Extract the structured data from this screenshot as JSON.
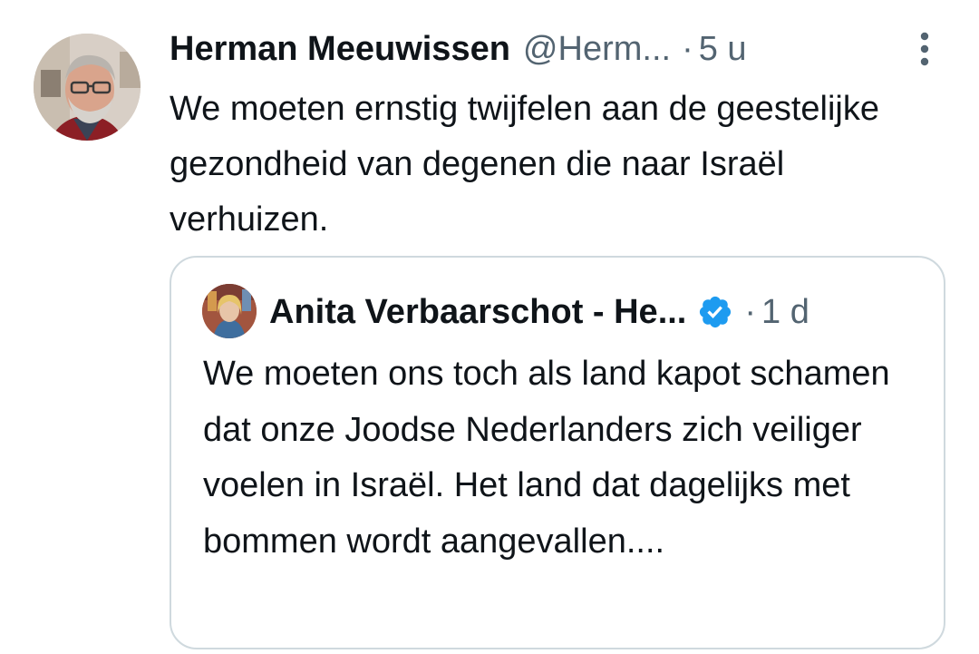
{
  "tweet": {
    "author_name": "Herman Meeuwissen",
    "author_handle": "@Herm...",
    "separator": "·",
    "time": "5 u",
    "text": "We moeten ernstig twijfelen aan de geestelijke gezondheid van degenen die naar Israël verhuizen."
  },
  "quoted_tweet": {
    "author_name": "Anita Verbaarschot - He...",
    "verified": true,
    "separator": "·",
    "time": "1 d",
    "text": "We moeten ons toch als land kapot schamen dat onze Joodse Nederlanders zich veiliger voelen in Israël. Het land dat dagelijks met bommen wordt aangevallen...."
  },
  "icons": {
    "more": "more-vertical-icon",
    "verified": "verified-badge-icon"
  },
  "colors": {
    "text_primary": "#0f1419",
    "text_secondary": "#536471",
    "border": "#cfd9de",
    "verified_blue": "#1d9bf0"
  }
}
